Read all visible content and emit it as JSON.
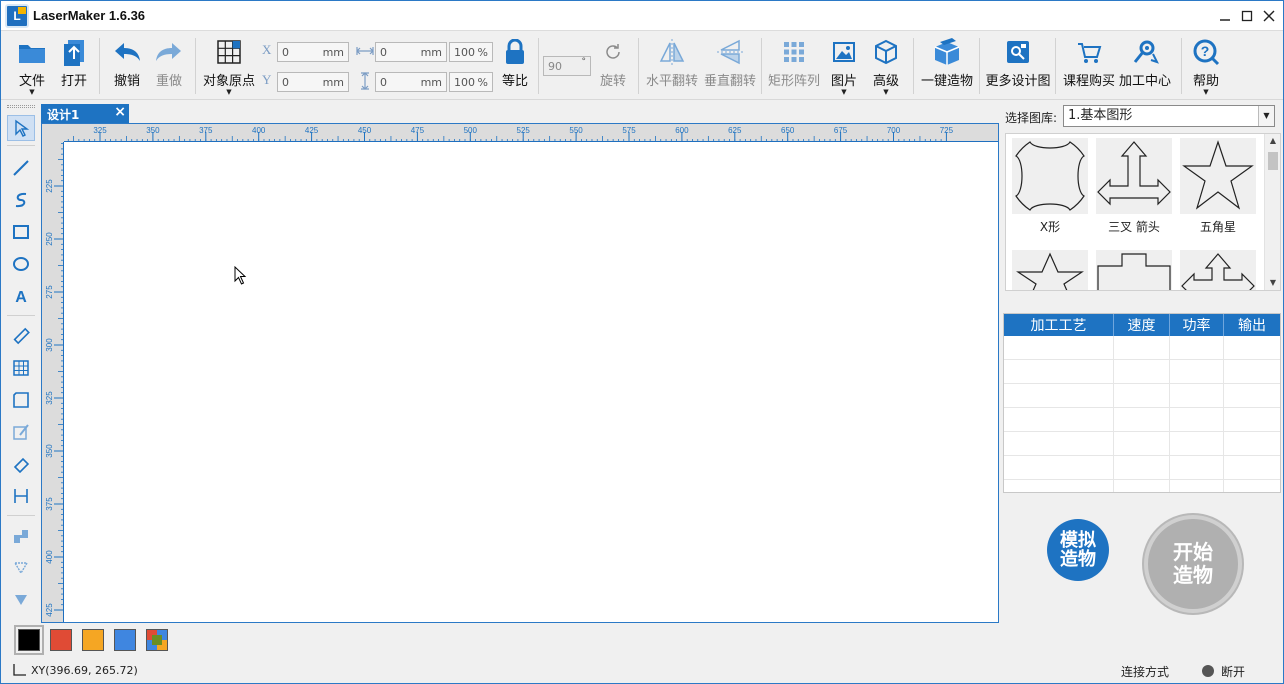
{
  "window": {
    "title": "LaserMaker 1.6.36",
    "logo_text": "L"
  },
  "toolbar": {
    "file": "文件",
    "open": "打开",
    "undo": "撤销",
    "redo": "重做",
    "origin": "对象原点",
    "x_label": "X",
    "y_label": "Y",
    "x_value": "0",
    "y_value": "0",
    "w_value": "0",
    "h_value": "0",
    "unit": "mm",
    "w_percent": "100",
    "h_percent": "100",
    "percent_unit": "%",
    "proportional": "等比",
    "rotate_value": "90",
    "rotate_unit": "°",
    "rotate": "旋转",
    "flip_h": "水平翻转",
    "flip_v": "垂直翻转",
    "array": "矩形阵列",
    "image": "图片",
    "advanced": "高级",
    "one_click": "一键造物",
    "more_designs": "更多设计图",
    "course_buy": "课程购买",
    "process_center": "加工中心",
    "help": "帮助"
  },
  "tab": {
    "label": "设计1",
    "close": "×"
  },
  "rulers": {
    "h_ticks": [
      "325",
      "350",
      "375",
      "400",
      "425",
      "450",
      "475",
      "500",
      "525",
      "550",
      "575",
      "600",
      "625",
      "650",
      "675",
      "700",
      "725"
    ],
    "v_ticks": [
      "225",
      "250",
      "275",
      "300",
      "325",
      "350",
      "375",
      "400",
      "425"
    ]
  },
  "library": {
    "label": "选择图库:",
    "selected": "1.基本图形",
    "shapes": [
      {
        "name": "X形",
        "icon": "x-shape-icon"
      },
      {
        "name": "三叉 箭头",
        "icon": "trident-arrow-icon"
      },
      {
        "name": "五角星",
        "icon": "five-point-star-icon"
      },
      {
        "name": "",
        "icon": "four-point-star-icon"
      },
      {
        "name": "",
        "icon": "plus-shape-icon"
      },
      {
        "name": "",
        "icon": "arrow-shape-icon"
      }
    ]
  },
  "layers": {
    "headers": [
      "加工工艺",
      "速度",
      "功率",
      "输出"
    ]
  },
  "actions": {
    "simulate_line1": "模拟",
    "simulate_line2": "造物",
    "start_line1": "开始",
    "start_line2": "造物"
  },
  "palette": {
    "colors": [
      "#000000",
      "#e04b35",
      "#f5a623",
      "#3f86e0"
    ]
  },
  "status": {
    "coords": "XY(396.69, 265.72)",
    "connection_label": "连接方式",
    "connection_state": "断开"
  }
}
